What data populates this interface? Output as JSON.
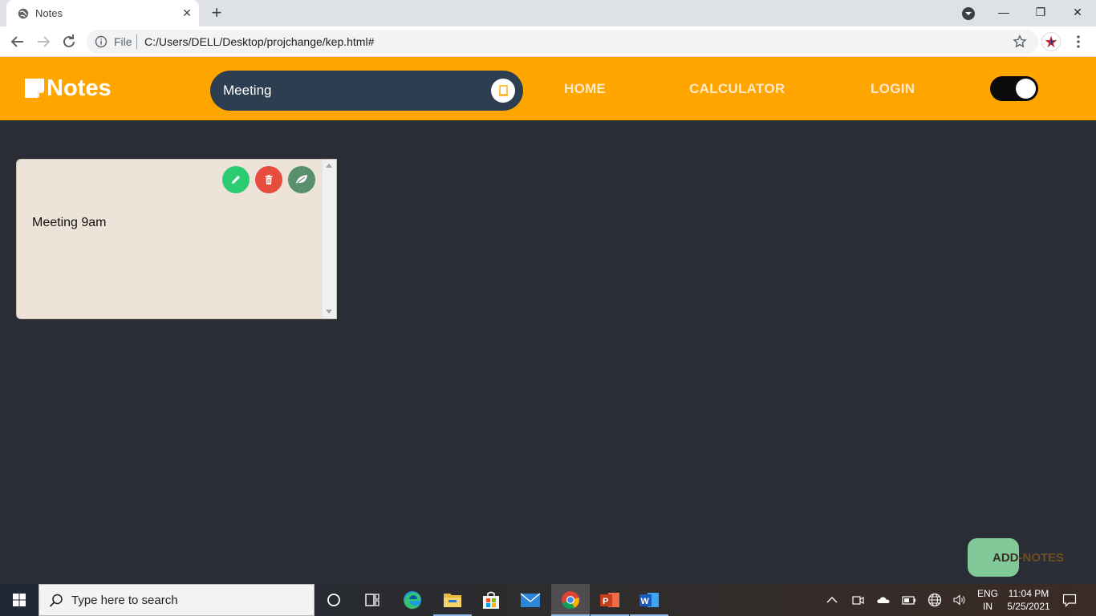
{
  "browser": {
    "tab_title": "Notes",
    "tab_close": "✕",
    "new_tab": "+",
    "file_label": "File",
    "url": "C:/Users/DELL/Desktop/projchange/kep.html#",
    "window_controls": {
      "minimize": "—",
      "restore": "❐",
      "close": "✕"
    }
  },
  "navbar": {
    "brand": "Notes",
    "search_value": "Meeting",
    "links": {
      "home": "HOME",
      "calculator": "CALCULATOR",
      "login": "LOGIN"
    },
    "toggle_on": true
  },
  "notes": [
    {
      "text": "Meeting 9am"
    }
  ],
  "add_button": {
    "label_head": "ADD",
    "label_tail": "-NOTES"
  },
  "taskbar": {
    "search_placeholder": "Type here to search",
    "language_top": "ENG",
    "language_bottom": "IN",
    "time": "11:04 PM",
    "date": "5/25/2021"
  },
  "colors": {
    "navbar": "#ffa500",
    "page_background": "#2a2d35",
    "note_background": "#ede3d8",
    "edit_button": "#2ecc71",
    "delete_button": "#e74c3c",
    "leaf_button": "#5a8f6e",
    "add_button": "#82c99a"
  },
  "icons": [
    "globe-icon",
    "search-icon",
    "back-icon",
    "forward-icon",
    "reload-icon",
    "info-icon",
    "star-icon",
    "kebab-icon",
    "notes-logo-icon",
    "pencil-icon",
    "trash-icon",
    "leaf-icon",
    "windows-logo-icon",
    "cortana-icon",
    "task-view-icon",
    "edge-icon",
    "file-explorer-icon",
    "store-icon",
    "mail-icon",
    "chrome-icon",
    "powerpoint-icon",
    "word-icon",
    "chevron-up-icon",
    "meet-icon",
    "cloud-icon",
    "battery-icon",
    "network-icon",
    "volume-icon",
    "notification-icon"
  ]
}
